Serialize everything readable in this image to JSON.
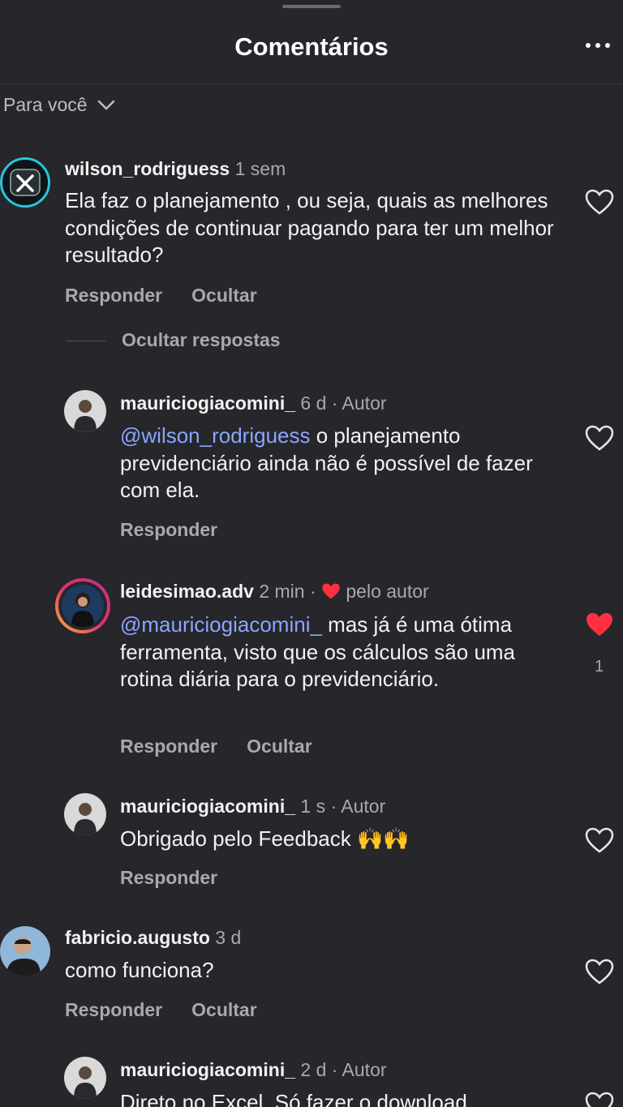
{
  "header": {
    "title": "Comentários",
    "more_icon": "more-horizontal-icon"
  },
  "sort": {
    "label": "Para você"
  },
  "comments": [
    {
      "user": "wilson_rodriguess",
      "time": "1 sem",
      "text": "Ela faz o planejamento , ou seja, quais as melhores condições de continuar pagando para ter um melhor resultado?",
      "reply": "Responder",
      "hide": "Ocultar"
    },
    {
      "user": "fabricio.augusto",
      "time": "3 d",
      "text": "como funciona?",
      "reply": "Responder",
      "hide": "Ocultar"
    }
  ],
  "hide_replies": "Ocultar respostas",
  "replies": [
    {
      "user": "mauriciogiacomini_",
      "time": "6 d · Autor",
      "mention": "@wilson_rodriguess",
      "text": " o planejamento previdenciário ainda não é possível de fazer com ela.",
      "reply": "Responder"
    },
    {
      "user": "leidesimao.adv",
      "time": "2 min ·",
      "liked_by": "pelo autor",
      "mention": "@mauriciogiacomini_",
      "text": " mas já é uma ótima ferramenta, visto que os cálculos são uma rotina diária para o previdenciário.",
      "reply": "Responder",
      "hide": "Ocultar",
      "like_count": "1"
    },
    {
      "user": "mauriciogiacomini_",
      "time": "1 s · Autor",
      "text": "Obrigado pelo Feedback 🙌🙌",
      "reply": "Responder"
    },
    {
      "user": "mauriciogiacomini_",
      "time": "2 d · Autor",
      "text": "Direto no Excel. Só fazer o download"
    }
  ],
  "colors": {
    "background": "#26262b",
    "mention": "#8aa6ff",
    "liked_heart": "#ff3040",
    "muted": "#a8a8ae"
  }
}
